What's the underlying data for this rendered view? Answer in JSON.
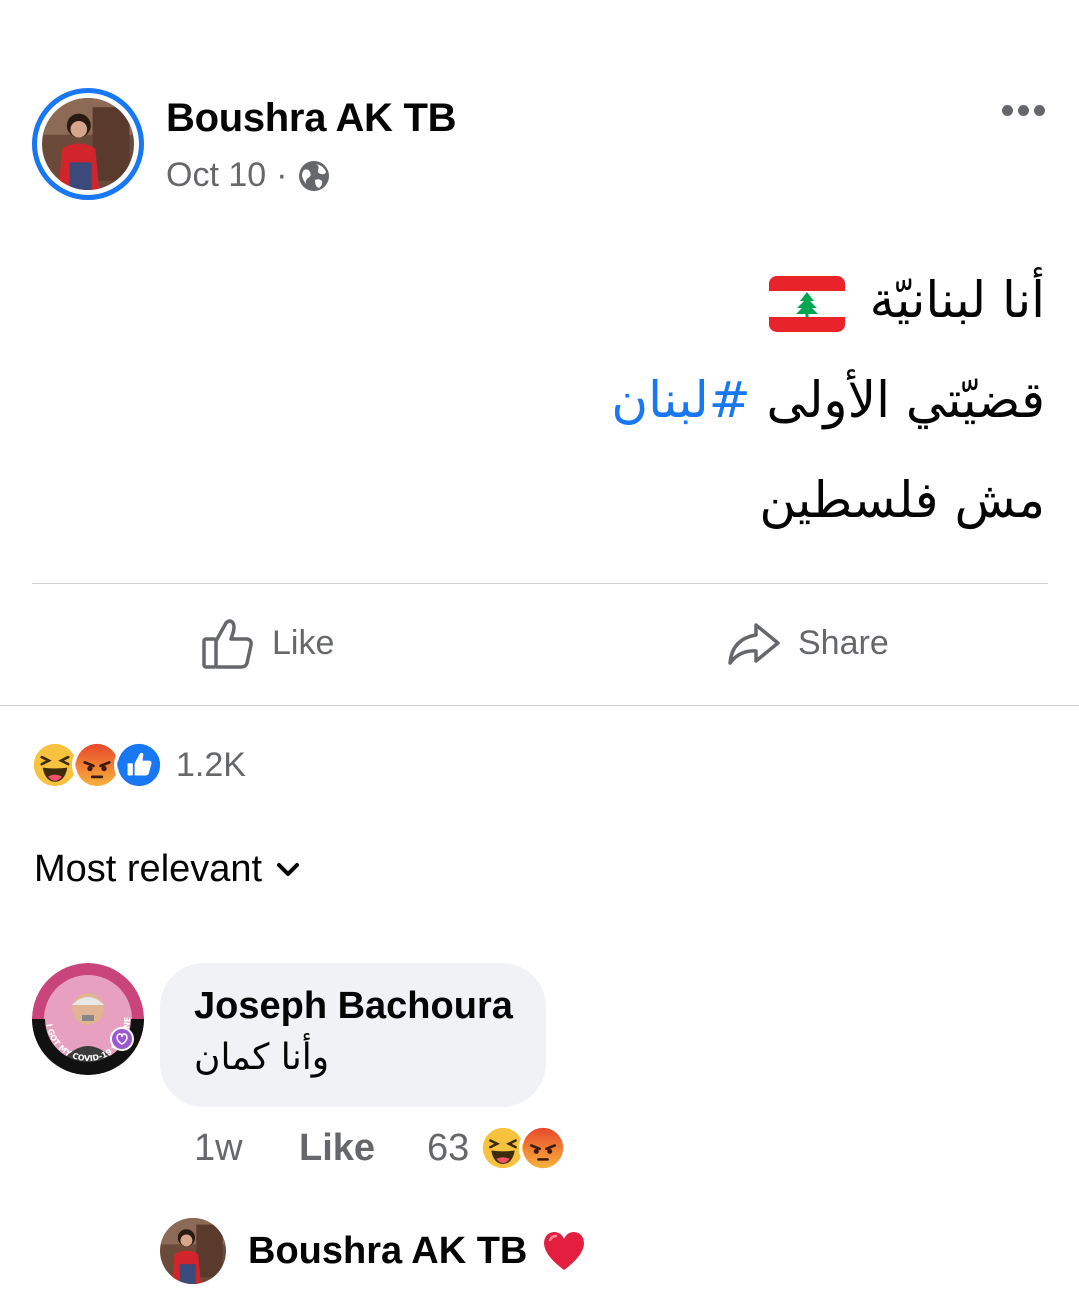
{
  "post": {
    "author": "Boushra AK TB",
    "date": "Oct 10",
    "separator": "·",
    "privacy_icon": "globe-icon",
    "lines": [
      {
        "text": "أنا لبنانيّة",
        "emoji": "lebanon-flag-icon"
      },
      {
        "text": "قضيّتي الأولى ",
        "hashtag": "#لبنان"
      },
      {
        "text": "مش فلسطين"
      }
    ]
  },
  "actions": {
    "like_label": "Like",
    "share_label": "Share"
  },
  "reactions": {
    "icons": [
      "haha-icon",
      "angry-icon",
      "like-icon"
    ],
    "count": "1.2K"
  },
  "comments_sort": {
    "label": "Most relevant"
  },
  "comment": {
    "author": "Joseph Bachoura",
    "text": "وأنا كمان",
    "avatar_frame_text": "I GOT MY COVID-19 VACCINE",
    "time": "1w",
    "like_label": "Like",
    "reaction_count": "63",
    "reaction_icons": [
      "haha-icon",
      "angry-icon"
    ]
  },
  "reply": {
    "author": "Boushra AK TB",
    "reaction_icon": "red-heart-icon"
  },
  "colors": {
    "accent": "#1877f2",
    "secondary_text": "#65676b",
    "bubble_bg": "#f0f2f5",
    "angry": "#f0743b",
    "haha": "#f7c33e",
    "heart": "#e41e3f"
  }
}
